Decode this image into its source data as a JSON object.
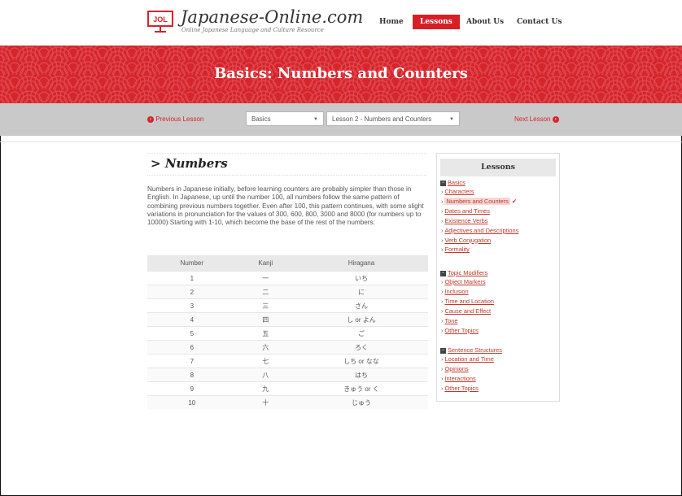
{
  "header": {
    "brand": "Japanese-Online.com",
    "tagline": "Online Japanese Language and Culture Resource",
    "logo_text": "JOL",
    "nav": [
      {
        "label": "Home"
      },
      {
        "label": "Lessons"
      },
      {
        "label": "About Us"
      },
      {
        "label": "Contact Us"
      }
    ]
  },
  "banner": {
    "title": "Basics: Numbers and Counters"
  },
  "lesson_nav": {
    "previous": "Previous Lesson",
    "next": "Next Lesson",
    "prev_icon": "chevron-left-circle-icon",
    "next_icon": "chevron-right-circle-icon",
    "category_select": "Basics",
    "lesson_select": "Lesson 2 - Numbers and Counters"
  },
  "main": {
    "title": "Numbers",
    "intro": "Numbers in Japanese initially, before learning counters are probably simpler than those in English. In Japanese, up until the number 100, all numbers follow the same pattern of combining previous numbers together. Even after 100, this pattern continues, with some slight variations in pronunciation for the values of 300, 600, 800, 3000 and 8000 (for numbers up to 10000) Starting with 1-10, which become the base of the rest of the numbers:",
    "table": {
      "headers": [
        "Number",
        "Kanji",
        "Hiragana"
      ],
      "rows": [
        [
          "1",
          "一",
          "いち"
        ],
        [
          "2",
          "二",
          "に"
        ],
        [
          "3",
          "三",
          "さん"
        ],
        [
          "4",
          "四",
          "し or よん"
        ],
        [
          "5",
          "五",
          "ご"
        ],
        [
          "6",
          "六",
          "ろく"
        ],
        [
          "7",
          "七",
          "しち or なな"
        ],
        [
          "8",
          "八",
          "はち"
        ],
        [
          "9",
          "九",
          "きゅう or く"
        ],
        [
          "10",
          "十",
          "じゅう"
        ]
      ]
    }
  },
  "sidebar": {
    "title": "Lessons",
    "groups": [
      {
        "name": "Basics",
        "items": [
          "Characters",
          "Numbers and Counters",
          "Dates and Times",
          "Existence Verbs",
          "Adjectives and Descriptions",
          "Verb Conjugation",
          "Formality"
        ]
      },
      {
        "name": "Topic Modifiers",
        "items": [
          "Object Markers",
          "Inclusion",
          "Time and Location",
          "Cause and Effect",
          "Tone",
          "Other Topics"
        ]
      },
      {
        "name": "Sentence Structures",
        "items": [
          "Location and Time",
          "Opinions",
          "Interactions",
          "Other Topics"
        ]
      }
    ],
    "active_item": "Numbers and Counters",
    "check_glyph": "✔"
  },
  "colors": {
    "accent": "#d6252c",
    "bar": "#c9c9c9",
    "sidebar_head": "#e8e8e8"
  }
}
